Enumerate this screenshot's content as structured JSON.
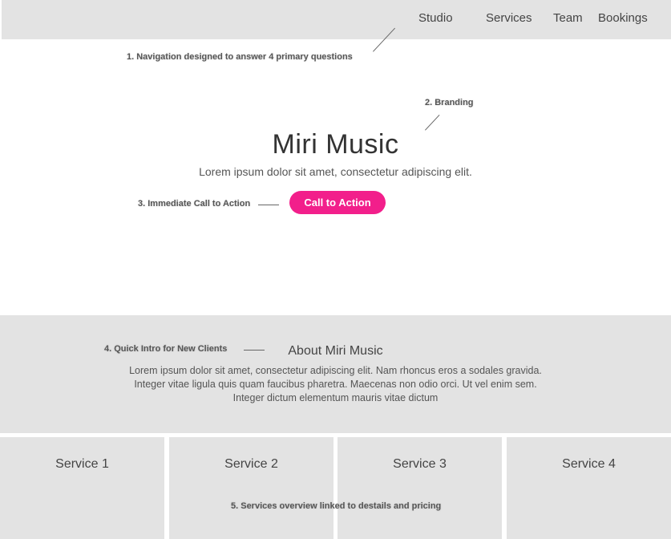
{
  "nav": {
    "items": [
      {
        "label": "Studio"
      },
      {
        "label": "Services"
      },
      {
        "label": "Team"
      },
      {
        "label": "Bookings"
      }
    ]
  },
  "annotations": {
    "a1": "1. Navigation designed to answer  4 primary questions",
    "a2": "2. Branding",
    "a3": "3. Immediate Call to Action",
    "a4": "4. Quick Intro for New Clients",
    "a5": "5. Services overview linked to destails and pricing"
  },
  "hero": {
    "title": "Miri Music",
    "subtitle": "Lorem ipsum dolor sit amet, consectetur adipiscing elit.",
    "cta_label": "Call to Action"
  },
  "about": {
    "title": "About Miri Music",
    "lines": [
      "Lorem ipsum dolor sit amet, consectetur adipiscing elit. Nam rhoncus eros a sodales gravida.",
      "Integer vitae ligula quis quam faucibus pharetra. Maecenas non odio orci. Ut vel enim sem.",
      "Integer dictum elementum mauris vitae dictum"
    ]
  },
  "services": [
    {
      "label": "Service 1"
    },
    {
      "label": "Service 2"
    },
    {
      "label": "Service 3"
    },
    {
      "label": "Service 4"
    }
  ],
  "colors": {
    "accent": "#f21f8b",
    "panel": "#e3e3e3"
  }
}
